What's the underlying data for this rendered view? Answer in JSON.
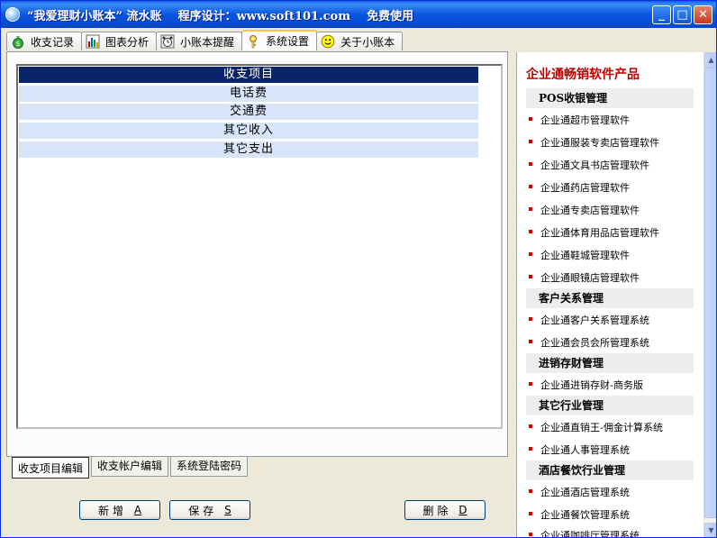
{
  "window": {
    "title": "“我爱理财小账本” 流水账    程序设计：www.soft101.com    免费使用",
    "minimize": "_",
    "maximize": "□",
    "close": "✕"
  },
  "tabs": [
    {
      "label": "收支记录",
      "icon": "money-bag-icon"
    },
    {
      "label": "图表分析",
      "icon": "bar-chart-icon"
    },
    {
      "label": "小账本提醒",
      "icon": "alarm-clock-icon"
    },
    {
      "label": "系统设置",
      "icon": "key-icon"
    },
    {
      "label": "关于小账本",
      "icon": "smiley-icon"
    }
  ],
  "active_tab": 3,
  "list": {
    "header": "收支项目",
    "items": [
      "电话费",
      "交通费",
      "其它收入",
      "其它支出"
    ]
  },
  "subtabs": [
    "收支项目编辑",
    "收支帐户编辑",
    "系统登陆密码"
  ],
  "buttons": {
    "add": {
      "label": "新增",
      "key": "A"
    },
    "save": {
      "label": "保存",
      "key": "S"
    },
    "delete": {
      "label": "删除",
      "key": "D"
    }
  },
  "sidebar": {
    "title": "企业通畅销软件产品",
    "categories": [
      {
        "name": "POS收银管理",
        "items": [
          "企业通超市管理软件",
          "企业通服装专卖店管理软件",
          "企业通文具书店管理软件",
          "企业通药店管理软件",
          "企业通专卖店管理软件",
          "企业通体育用品店管理软件",
          "企业通鞋城管理软件",
          "企业通眼镜店管理软件"
        ]
      },
      {
        "name": "客户关系管理",
        "items": [
          "企业通客户关系管理系统",
          "企业通会员会所管理系统"
        ]
      },
      {
        "name": "进销存财管理",
        "items": [
          "企业通进销存财-商务版"
        ]
      },
      {
        "name": "其它行业管理",
        "items": [
          "企业通直销王-佣金计算系统",
          "企业通人事管理系统"
        ]
      },
      {
        "name": "酒店餐饮行业管理",
        "items": [
          "企业通酒店管理系统",
          "企业通餐饮管理系统",
          "企业通咖啡厅管理系统"
        ]
      }
    ]
  }
}
